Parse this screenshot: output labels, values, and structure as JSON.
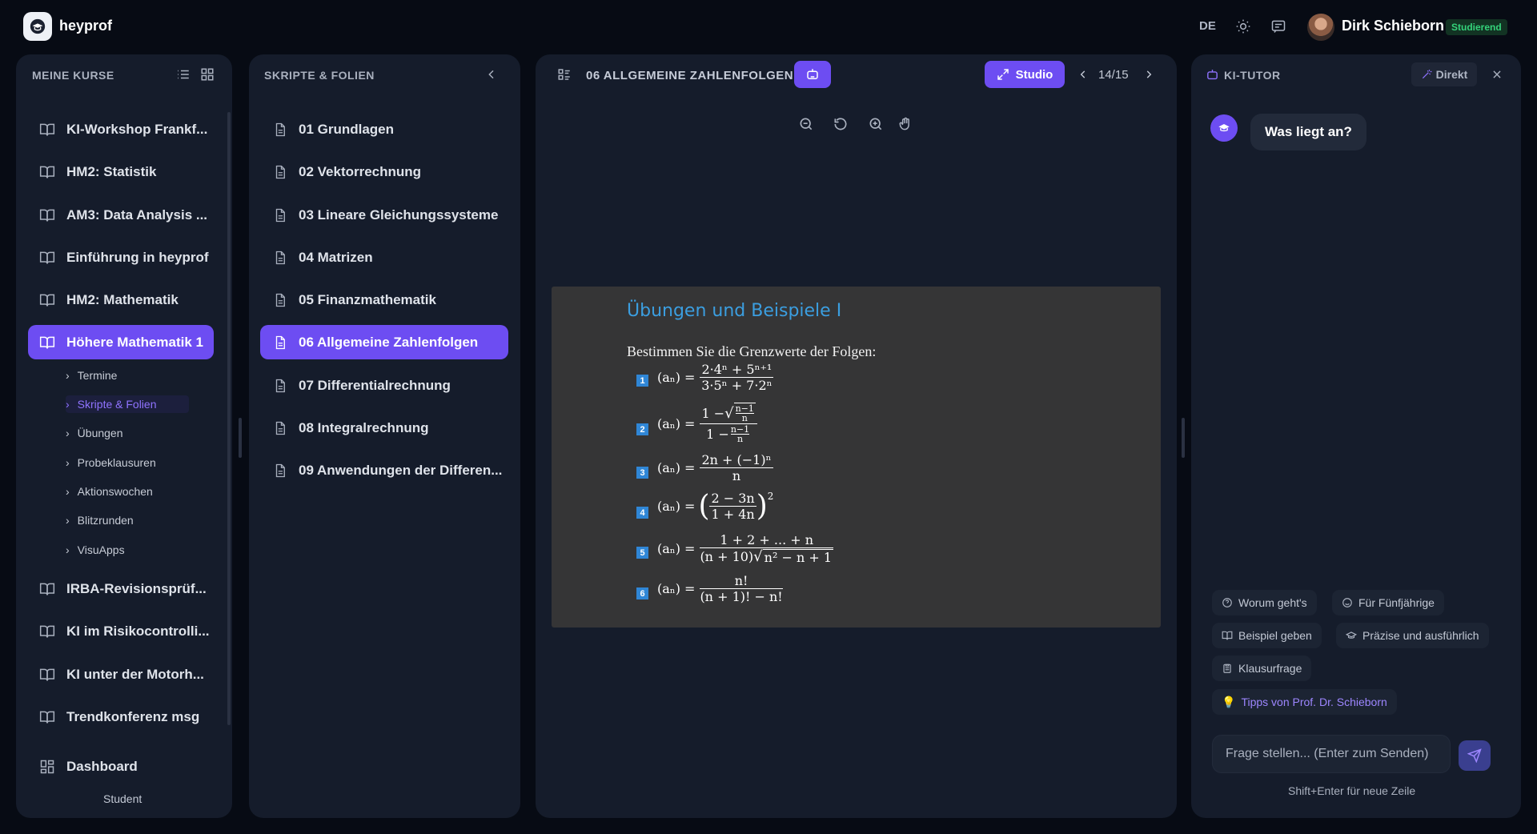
{
  "app": {
    "brand": "heyprof",
    "language": "DE",
    "user_name": "Dirk Schieborn",
    "user_role": "Studierend"
  },
  "courses_panel": {
    "title": "MEINE KURSE",
    "items": [
      {
        "label": "KI-Workshop Frankf..."
      },
      {
        "label": "HM2: Statistik"
      },
      {
        "label": "AM3: Data Analysis ..."
      },
      {
        "label": "Einführung in heyprof"
      },
      {
        "label": "HM2: Mathematik"
      },
      {
        "label": "Höhere Mathematik 1",
        "active": true
      },
      {
        "label": "IRBA-Revisionsprüf..."
      },
      {
        "label": "KI im Risikocontrolli..."
      },
      {
        "label": "KI unter der Motorh..."
      },
      {
        "label": "Trendkonferenz msg"
      }
    ],
    "sub_items": [
      "Termine",
      "Skripte & Folien",
      "Übungen",
      "Probeklausuren",
      "Aktionswochen",
      "Blitzrunden",
      "VisuApps"
    ],
    "active_sub": "Skripte & Folien",
    "dashboard_label": "Dashboard",
    "footer_label": "Student"
  },
  "slides_panel": {
    "title": "SKRIPTE & FOLIEN",
    "items": [
      "01 Grundlagen",
      "02 Vektorrechnung",
      "03 Lineare Gleichungssysteme",
      "04 Matrizen",
      "05 Finanzmathematik",
      "06 Allgemeine Zahlenfolgen",
      "07 Differentialrechnung",
      "08 Integralrechnung",
      "09 Anwendungen der Differen..."
    ],
    "active_index": 5
  },
  "viewer": {
    "title": "06 ALLGEMEINE ZAHLENFOLGEN",
    "studio_label": "Studio",
    "page_indicator": "14/15",
    "slide": {
      "title": "Übungen und Beispiele I",
      "prompt": "Bestimmen Sie die Grenzwerte der Folgen:",
      "numbers": [
        "1",
        "2",
        "3",
        "4",
        "5",
        "6"
      ],
      "equations": {
        "e1": {
          "lhs": "(aₙ) =",
          "num": "2·4ⁿ + 5ⁿ⁺¹",
          "den": "3·5ⁿ + 7·2ⁿ"
        },
        "e2": {
          "lhs": "(aₙ) =",
          "num_a": "1 − ",
          "num_root": "n−1",
          "num_root_den": "n",
          "den_a": "1 − ",
          "den_frac_num": "n−1",
          "den_frac_den": "n"
        },
        "e3": {
          "lhs": "(aₙ) =",
          "num": "2n + (−1)ⁿ",
          "den": "n"
        },
        "e4": {
          "lhs": "(aₙ) =",
          "num": "2 − 3n",
          "den": "1 + 4n",
          "power": "2"
        },
        "e5": {
          "lhs": "(aₙ) =",
          "num": "1 + 2 + ... + n",
          "den_a": "(n + 10)",
          "den_root": "n² − n + 1"
        },
        "e6": {
          "lhs": "(aₙ) =",
          "num": "n!",
          "den": "(n + 1)! − n!"
        }
      }
    }
  },
  "tutor": {
    "title": "KI-TUTOR",
    "mode_label": "Direkt",
    "greeting": "Was liegt an?",
    "chips": [
      "Worum geht's",
      "Für Fünfjährige",
      "Beispiel geben",
      "Präzise und ausführlich",
      "Klausurfrage"
    ],
    "tip_chip": "Tipps von Prof. Dr. Schieborn",
    "input_placeholder": "Frage stellen... (Enter zum Senden)",
    "hint": "Shift+Enter für neue Zeile"
  }
}
